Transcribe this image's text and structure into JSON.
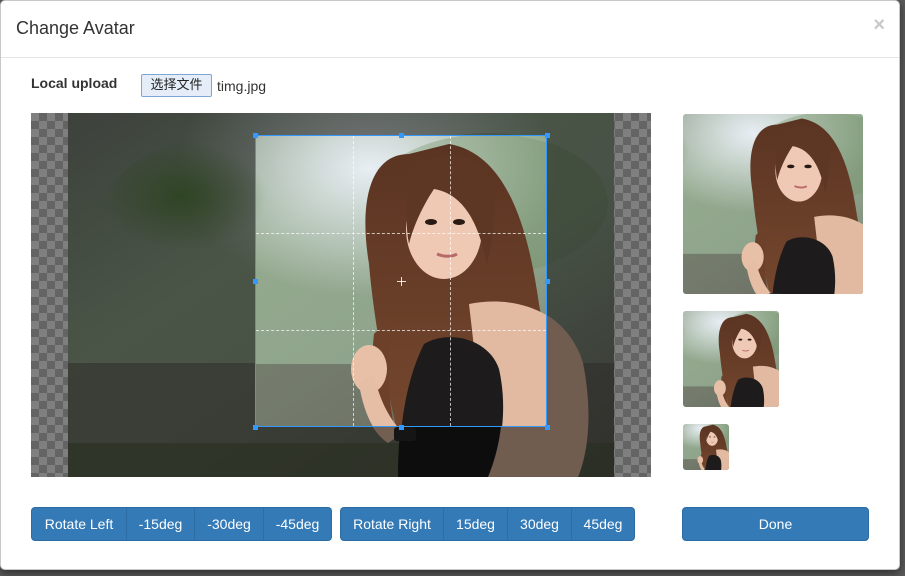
{
  "dialog": {
    "title": "Change Avatar",
    "close_symbol": "×"
  },
  "upload": {
    "label": "Local upload",
    "choose_file_label": "选择文件",
    "file_name": "timg.jpg"
  },
  "rotate_left": {
    "main_label": "Rotate Left",
    "options": [
      "-15deg",
      "-30deg",
      "-45deg"
    ]
  },
  "rotate_right": {
    "main_label": "Rotate Right",
    "options": [
      "15deg",
      "30deg",
      "45deg"
    ]
  },
  "done_label": "Done",
  "colors": {
    "primary": "#337ab7",
    "crop_border": "#3399ff"
  }
}
